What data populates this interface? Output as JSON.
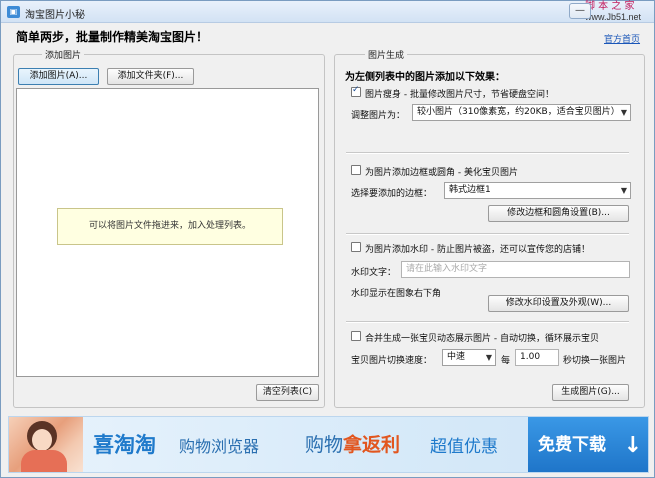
{
  "window": {
    "title": "淘宝图片小秘",
    "watermark_line1": "脚 本 之 家",
    "watermark_url": "www.Jb51.net",
    "minimize_label": "—"
  },
  "header": {
    "slogan": "简单两步，批量制作精美淘宝图片！",
    "home_link": "官方首页"
  },
  "add_images": {
    "group_title": "添加图片",
    "add_image_button": "添加图片(A)...",
    "add_folder_button": "添加文件夹(F)...",
    "drop_hint": "可以将图片文件拖进来，加入处理列表。",
    "clear_list_button": "清空列表(C)"
  },
  "generate": {
    "group_title": "图片生成",
    "section_title": "为左侧列表中的图片添加以下效果：",
    "resize": {
      "checked": true,
      "checkbox_label": "图片瘦身 - 批量修改图片尺寸，节省硬盘空间！",
      "size_label": "调整图片为：",
      "size_value": "较小图片（310像素宽，约20KB，适合宝贝图片）"
    },
    "border": {
      "checked": false,
      "checkbox_label": "为图片添加边框或圆角 - 美化宝贝图片",
      "border_label": "选择要添加的边框：",
      "border_value": "韩式边框1",
      "settings_button": "修改边框和圆角设置(B)..."
    },
    "watermark": {
      "checked": false,
      "checkbox_label": "为图片添加水印 - 防止图片被盗，还可以宣传您的店铺！",
      "text_label": "水印文字：",
      "text_placeholder": "请在此输入水印文字",
      "position_text": "水印显示在图象右下角",
      "settings_button": "修改水印设置及外观(W)..."
    },
    "slideshow": {
      "checked": false,
      "checkbox_label": "合并生成一张宝贝动态展示图片 - 自动切换，循环展示宝贝",
      "speed_label": "宝贝图片切换速度：",
      "speed_value": "中速",
      "every_label": "每",
      "interval_value": "1.00",
      "suffix_label": "秒切换一张图片"
    },
    "generate_button": "生成图片(G)..."
  },
  "banner": {
    "brand": "喜淘淘",
    "subtitle": "购物浏览器",
    "cashback_prefix": "购物",
    "cashback_highlight": "拿返利",
    "deal": "超值优惠",
    "download": "免费下载",
    "download_arrow": "↓"
  }
}
